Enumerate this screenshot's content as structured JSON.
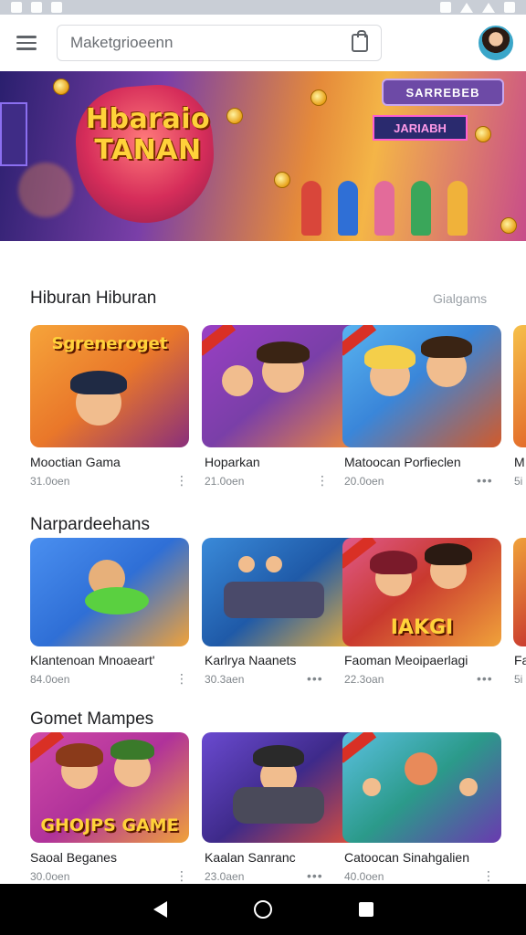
{
  "status_bar": {
    "icons": [
      "notification-icon",
      "notification-icon",
      "notification-icon",
      "bluetooth-icon",
      "wifi-icon",
      "signal-icon",
      "battery-icon"
    ]
  },
  "app_bar": {
    "search_placeholder": "Maketgrioeenn",
    "colors": {
      "border": "#dadce0",
      "icon": "#5f6368"
    }
  },
  "banner": {
    "title": "Hbaraio TANAN",
    "sign_top": "SARREBEB",
    "sign_mid": "JARIABH",
    "colors": {
      "start": "#2a1f6e",
      "mid": "#e58a3a",
      "end": "#c84c8a"
    }
  },
  "sections": [
    {
      "title": "Hiburan Hiburan",
      "action": "Gialgams",
      "cards": [
        {
          "name": "Mooctian Gama",
          "meta": "31.0oen",
          "more": "⋮",
          "headline": "Sgreneroget",
          "art": "#e9772a"
        },
        {
          "name": "Hoparkan",
          "meta": "21.0oen",
          "more": "⋮",
          "headline": "",
          "art": "#7a3fa8"
        },
        {
          "name": "Matoocan Porfieclen",
          "meta": "20.0oen",
          "more": "•••",
          "headline": "",
          "art": "#3a86d9"
        }
      ],
      "peek": {
        "name": "M",
        "meta": "5i"
      }
    },
    {
      "title": "Narpardeehans",
      "action": "",
      "cards": [
        {
          "name": "Klantenoan Mnoaeart'",
          "meta": "84.0oen",
          "more": "⋮",
          "headline": "",
          "art": "#2f6fd6"
        },
        {
          "name": "Karlrya Naanets",
          "meta": "30.3aen",
          "more": "•••",
          "headline": "",
          "art": "#1f5aa8"
        },
        {
          "name": "Faoman Meoipaerlagi",
          "meta": "22.3oan",
          "more": "•••",
          "headline": "IAKGI",
          "art": "#c9392f"
        }
      ],
      "peek": {
        "name": "Fa",
        "meta": "5i"
      }
    },
    {
      "title": "Gomet Mampes",
      "action": "",
      "cards": [
        {
          "name": "Saoal Beganes",
          "meta": "30.0oen",
          "more": "⋮",
          "headline": "GHOJPS GAME",
          "art": "#b0329a"
        },
        {
          "name": "Kaalan Sanranc",
          "meta": "23.0aen",
          "more": "•••",
          "headline": "",
          "art": "#3e2a8a"
        },
        {
          "name": "Catoocan Sinahgalien",
          "meta": "40.0oen",
          "more": "⋮",
          "headline": "",
          "art": "#2b9a8a"
        }
      ]
    }
  ],
  "nav_bar": {
    "back": "back-icon",
    "home": "home-icon",
    "recent": "recent-apps-icon"
  }
}
